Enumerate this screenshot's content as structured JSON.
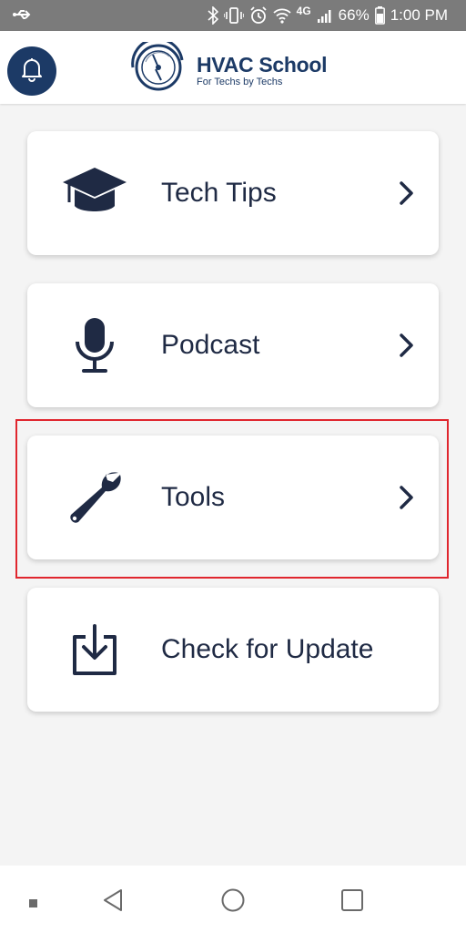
{
  "status_bar": {
    "network": "4G",
    "battery_percent": "66%",
    "time": "1:00 PM",
    "icons": [
      "usb-icon",
      "bluetooth-icon",
      "vibrate-icon",
      "alarm-icon",
      "wifi-icon",
      "signal-icon",
      "battery-icon"
    ]
  },
  "header": {
    "logo_title": "HVAC School",
    "logo_subtitle": "For Techs by Techs",
    "bell_icon": "bell-icon",
    "accent_color": "#1c3a66"
  },
  "menu": {
    "items": [
      {
        "label": "Tech Tips",
        "icon": "graduation-cap-icon",
        "has_chevron": true
      },
      {
        "label": "Podcast",
        "icon": "microphone-icon",
        "has_chevron": true
      },
      {
        "label": "Tools",
        "icon": "wrench-icon",
        "has_chevron": true,
        "highlighted": true
      },
      {
        "label": "Check for Update",
        "icon": "download-icon",
        "has_chevron": false
      }
    ]
  },
  "nav_bar": {
    "buttons": [
      "recents-dot-icon",
      "back-icon",
      "home-icon",
      "overview-icon"
    ]
  },
  "highlight_color": "#e0262e"
}
